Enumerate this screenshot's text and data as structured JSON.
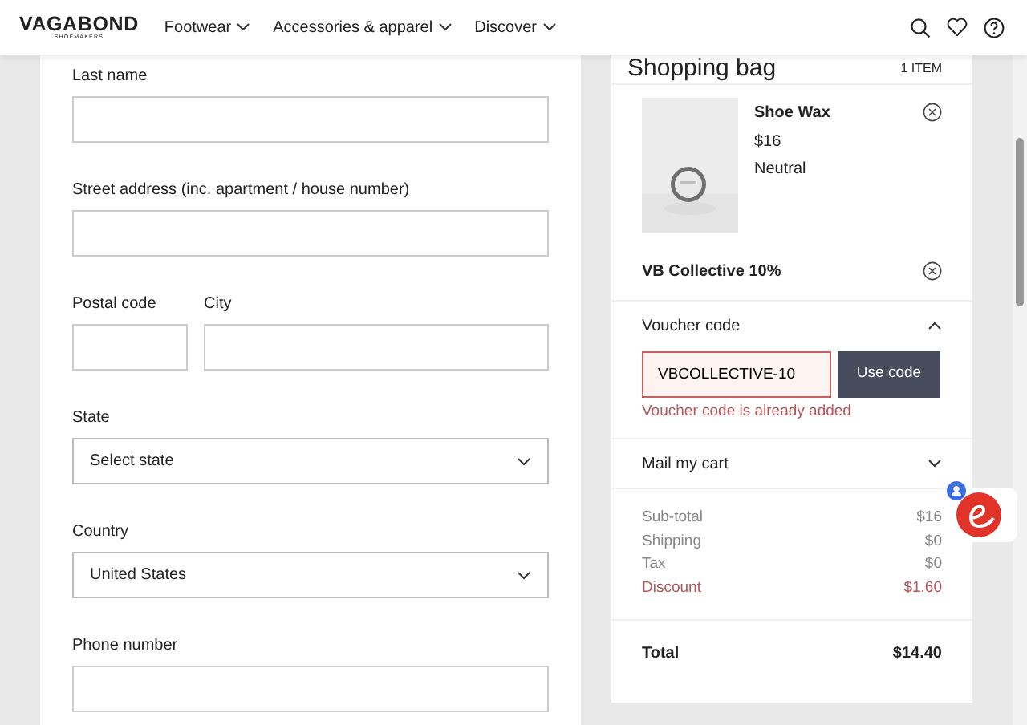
{
  "header": {
    "brand": "VAGABOND",
    "brand_sub": "SHOEMAKERS",
    "nav": [
      {
        "label": "Footwear"
      },
      {
        "label": "Accessories & apparel"
      },
      {
        "label": "Discover"
      }
    ]
  },
  "form": {
    "rows": [
      [
        {
          "label": "Last name",
          "kind": "text"
        }
      ],
      [
        {
          "label": "Street address (inc. apartment / house number)",
          "kind": "text"
        }
      ],
      [
        {
          "label": "Postal code",
          "kind": "text"
        },
        {
          "label": "City",
          "kind": "text"
        }
      ],
      [
        {
          "label": "State",
          "kind": "select",
          "value": "Select state"
        }
      ],
      [
        {
          "label": "Country",
          "kind": "select",
          "value": "United States"
        }
      ],
      [
        {
          "label": "Phone number",
          "kind": "text"
        }
      ]
    ]
  },
  "bag": {
    "title": "Shopping bag",
    "count": "1 ITEM",
    "item": {
      "kind": "picture",
      "name": "Shoe Wax",
      "price": "$16",
      "variant": "Neutral"
    },
    "promo": "VB Collective 10%",
    "voucher": {
      "title": "Voucher code",
      "expanded": true,
      "value": "VBCOLLECTIVE-10",
      "button": "Use code",
      "error": "Voucher code is already added"
    },
    "mail": {
      "title": "Mail my cart",
      "expanded": false
    },
    "summary": [
      {
        "label": "Sub-total",
        "value": "$16",
        "kind": "plain"
      },
      {
        "label": "Shipping",
        "value": "$0",
        "kind": "plain"
      },
      {
        "label": "Tax",
        "value": "$0",
        "kind": "plain"
      },
      {
        "label": "Discount",
        "value": "$1.60",
        "kind": "discount"
      }
    ],
    "total": {
      "label": "Total",
      "value": "$14.40"
    }
  }
}
